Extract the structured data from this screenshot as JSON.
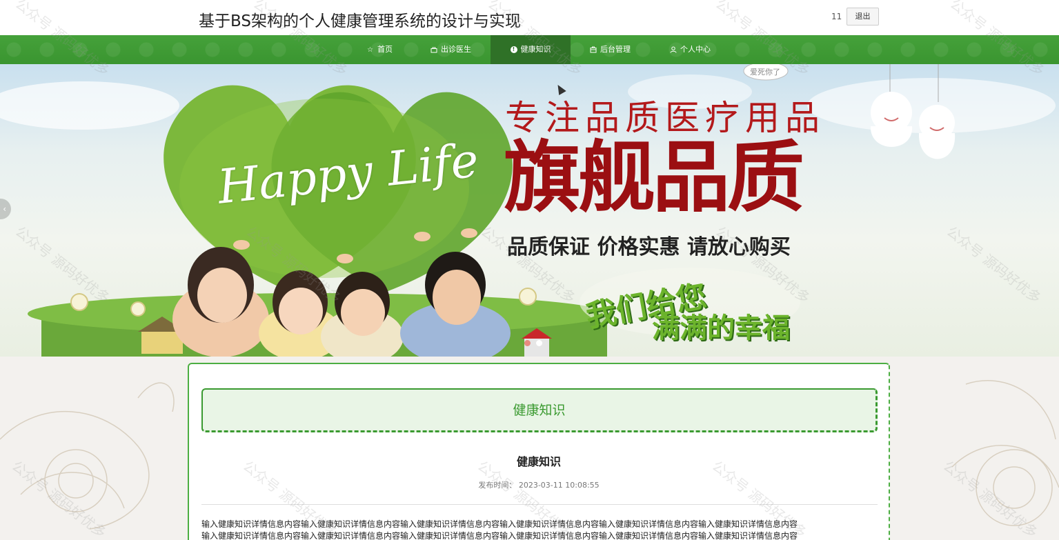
{
  "header": {
    "site_title": "基于BS架构的个人健康管理系统的设计与实现",
    "user_name": "11",
    "logout_label": "退出"
  },
  "nav": {
    "items": [
      {
        "label": "首页",
        "icon": "star-icon"
      },
      {
        "label": "出诊医生",
        "icon": "bag-icon"
      },
      {
        "label": "健康知识",
        "icon": "info-icon",
        "active": true
      },
      {
        "label": "后台管理",
        "icon": "briefcase-icon"
      },
      {
        "label": "个人中心",
        "icon": "user-icon"
      }
    ]
  },
  "banner": {
    "headline_small": "专注品质医疗用品",
    "headline_big": "旗舰品质",
    "subline": "品质保证 价格实惠 请放心购买",
    "slogan_line1": "我们给您",
    "slogan_line2": "满满的幸福",
    "script_text": "Happy Life",
    "cloud_text": "爱死你了"
  },
  "content": {
    "section_title": "健康知识",
    "article_title": "健康知识",
    "publish_label": "发布时间：",
    "publish_time": "2023-03-11 10:08:55",
    "body_line1": "输入健康知识详情信息内容输入健康知识详情信息内容输入健康知识详情信息内容输入健康知识详情信息内容输入健康知识详情信息内容输入健康知识详情信息内容",
    "body_line2": "输入健康知识详情信息内容输入健康知识详情信息内容输入健康知识详情信息内容输入健康知识详情信息内容输入健康知识详情信息内容输入健康知识详情信息内容"
  },
  "watermark": {
    "text": "公众号 源码好优多"
  },
  "colors": {
    "nav_green": "#3a9a30",
    "nav_active": "#2f7127",
    "title_green": "#3a9a30",
    "banner_red": "#9b0f12"
  }
}
